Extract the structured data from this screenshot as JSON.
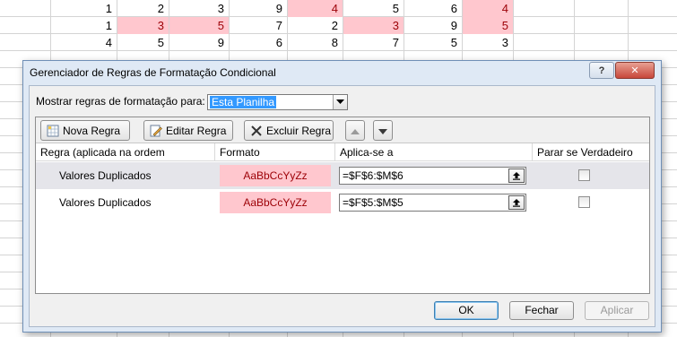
{
  "sheet": {
    "rows": [
      [
        "1",
        "2",
        "3",
        "9",
        "4",
        "5",
        "6",
        "4"
      ],
      [
        "1",
        "3",
        "5",
        "7",
        "2",
        "3",
        "9",
        "5"
      ],
      [
        "4",
        "5",
        "9",
        "6",
        "8",
        "7",
        "5",
        "3"
      ]
    ],
    "duplicate_highlight": [
      [
        false,
        false,
        false,
        false,
        true,
        false,
        false,
        true
      ],
      [
        false,
        true,
        true,
        false,
        false,
        true,
        false,
        true
      ],
      [
        false,
        false,
        false,
        false,
        false,
        false,
        false,
        false
      ]
    ]
  },
  "dialog": {
    "title": "Gerenciador de Regras de Formatação Condicional",
    "help_label": "?",
    "close_label": "✕",
    "show_rules_label": "Mostrar regras de formatação para:",
    "scope_value": "Esta Planilha",
    "toolbar": {
      "new_rule": "Nova Regra",
      "edit_rule": "Editar Regra",
      "delete_rule": "Excluir Regra"
    },
    "columns": {
      "rule": "Regra (aplicada na ordem mostrada)",
      "format": "Formato",
      "applies_to": "Aplica-se a",
      "stop_if_true": "Parar se Verdadeiro"
    },
    "rules": [
      {
        "name": "Valores Duplicados",
        "format_preview": "AaBbCcYyZz",
        "applies_to": "=$F$6:$M$6",
        "stop_if_true": false,
        "selected": true
      },
      {
        "name": "Valores Duplicados",
        "format_preview": "AaBbCcYyZz",
        "applies_to": "=$F$5:$M$5",
        "stop_if_true": false,
        "selected": false
      }
    ],
    "buttons": {
      "ok": "OK",
      "close": "Fechar",
      "apply": "Aplicar"
    }
  },
  "colors": {
    "duplicate_fill": "#ffc7ce",
    "duplicate_text": "#9c0006",
    "selection": "#3399ff",
    "dialog_frame": "#dfe9f5"
  }
}
